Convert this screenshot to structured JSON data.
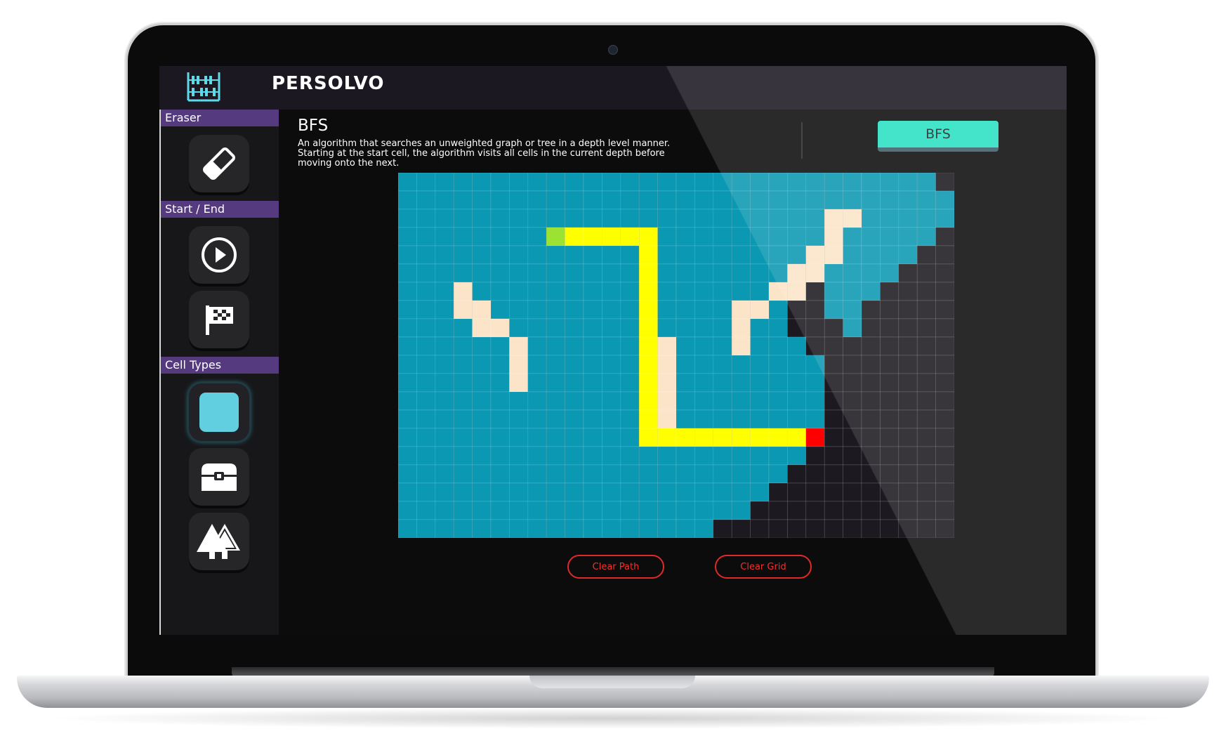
{
  "app": {
    "title": "PERSOLVO",
    "logo_icon": "abacus-logo-icon"
  },
  "sidebar": {
    "sections": [
      {
        "label": "Eraser",
        "tools": [
          {
            "icon": "eraser-icon"
          }
        ]
      },
      {
        "label": "Start / End",
        "tools": [
          {
            "icon": "play-circle-icon"
          },
          {
            "icon": "checkered-flag-icon"
          }
        ]
      },
      {
        "label": "Cell Types",
        "tools": [
          {
            "icon": "water-square-icon",
            "selected": true
          },
          {
            "icon": "treasure-chest-icon"
          },
          {
            "icon": "forest-icon"
          }
        ]
      }
    ]
  },
  "algorithm": {
    "title": "BFS",
    "description": "An algorithm that searches an unweighted graph or tree in a depth level manner. Starting at the start cell, the algorithm visits all cells in the current depth before moving onto the next.",
    "button_label": "BFS"
  },
  "controls": {
    "clear_path": "Clear Path",
    "clear_grid": "Clear Grid"
  },
  "colors": {
    "visited": "#0b98b2",
    "unvisited": "#1c1a20",
    "wall": "#fce4c8",
    "path": "#ffff00",
    "start": "#9be233",
    "end": "#ff0000",
    "accent_purple": "#553a80",
    "accent_teal": "#2ae0c4"
  },
  "grid": {
    "columns": 30,
    "rows": 20,
    "legend": {
      ".": "visited",
      "#": "unvisited",
      "W": "wall",
      "P": "path",
      "S": "start",
      "E": "end"
    },
    "cells": [
      ".............................#",
      "..............................",
      ".......................WW.....",
      "........SPPPPP.........W.....#",
      ".............P........WW....##",
      ".............P.......WW....###",
      "...W.........P......WW#...####",
      "...WW........P....WW.##..#####",
      "....WW.......P....W..###.#####",
      "......W......PW...W...#######",
      "......W......PW........######",
      "......W......PW........######",
      ".............PW........######",
      ".............PW........######",
      ".............PPPPPPPPPE######",
      "......................#######",
      ".....................########",
      "....................#########",
      "...................##########",
      ".................############"
    ]
  }
}
